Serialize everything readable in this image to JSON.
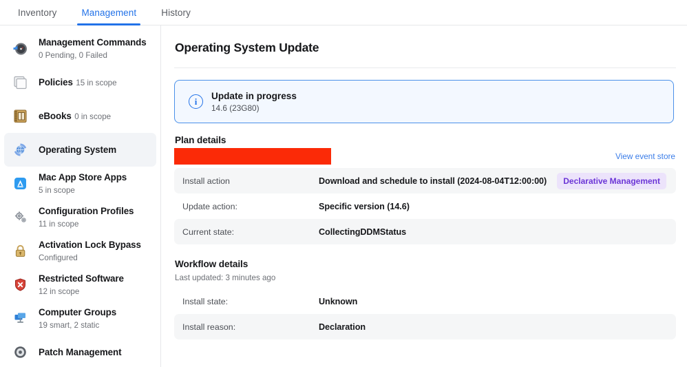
{
  "tabs": [
    {
      "label": "Inventory",
      "active": false
    },
    {
      "label": "Management",
      "active": true
    },
    {
      "label": "History",
      "active": false
    }
  ],
  "sidebar": {
    "items": [
      {
        "title": "Management Commands",
        "subtitle": "0 Pending, 0 Failed",
        "icon": "management-commands-icon",
        "selected": false
      },
      {
        "title": "Policies",
        "subtitle": "15 in scope",
        "icon": "policies-icon",
        "selected": false
      },
      {
        "title": "eBooks",
        "subtitle": "0 in scope",
        "icon": "ebooks-icon",
        "selected": false
      },
      {
        "title": "Operating System",
        "subtitle": "",
        "icon": "operating-system-icon",
        "selected": true
      },
      {
        "title": "Mac App Store Apps",
        "subtitle": "5 in scope",
        "icon": "mac-app-store-icon",
        "selected": false
      },
      {
        "title": "Configuration Profiles",
        "subtitle": "11 in scope",
        "icon": "configuration-profiles-icon",
        "selected": false
      },
      {
        "title": "Activation Lock Bypass",
        "subtitle": "Configured",
        "icon": "activation-lock-icon",
        "selected": false
      },
      {
        "title": "Restricted Software",
        "subtitle": "12 in scope",
        "icon": "restricted-software-icon",
        "selected": false
      },
      {
        "title": "Computer Groups",
        "subtitle": "19 smart, 2 static",
        "icon": "computer-groups-icon",
        "selected": false
      },
      {
        "title": "Patch Management",
        "subtitle": "",
        "icon": "patch-management-icon",
        "selected": false
      }
    ]
  },
  "main": {
    "page_title": "Operating System Update",
    "banner": {
      "icon": "info-icon",
      "title": "Update in progress",
      "subtitle": "14.6 (23G80)"
    },
    "plan": {
      "heading": "Plan details",
      "redacted": "",
      "view_event_store_label": "View event store",
      "rows": [
        {
          "label": "Install action",
          "value": "Download and schedule to install (2024-08-04T12:00:00)",
          "chip": "Declarative Management"
        },
        {
          "label": "Update action:",
          "value": "Specific version (14.6)",
          "chip": ""
        },
        {
          "label": "Current state:",
          "value": "CollectingDDMStatus",
          "chip": ""
        }
      ]
    },
    "workflow": {
      "heading": "Workflow details",
      "last_updated": "Last updated: 3 minutes ago",
      "rows": [
        {
          "label": "Install state:",
          "value": "Unknown"
        },
        {
          "label": "Install reason:",
          "value": "Declaration"
        }
      ]
    }
  },
  "colors": {
    "accent": "#2272e8",
    "redaction": "#fb2a07",
    "chip_bg": "#ece3fb",
    "chip_text": "#6b35d6",
    "banner_bg": "#f3f8ff",
    "row_alt": "#f5f6f7"
  }
}
